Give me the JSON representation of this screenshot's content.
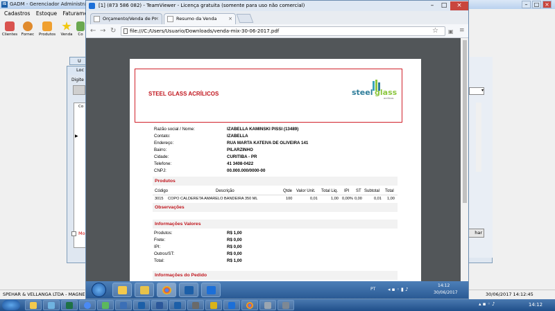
{
  "gadm": {
    "title": "GADM - Gerenciador Administrati",
    "menu": [
      "Cadastros",
      "Estoque",
      "Faturamento"
    ],
    "toolbar": [
      {
        "label": "Clientes",
        "icon": "clients-icon",
        "color": "#d9534f"
      },
      {
        "label": "Fornec",
        "icon": "supplier-icon",
        "color": "#e08a2c"
      },
      {
        "label": "Produtos",
        "icon": "products-icon",
        "color": "#f0a030"
      },
      {
        "label": "Venda",
        "icon": "sale-icon",
        "color": "#f2c811"
      },
      {
        "label": "Co",
        "icon": "other-icon",
        "color": "#6aa84f"
      }
    ],
    "child_title_1": "U",
    "child_title_2": "Loc",
    "group_label": "Digite",
    "grid_header": "Co",
    "checkbox_label": "Mo",
    "close_button": "har",
    "status_left": "SPEHAR & VELLANGA LTDA - MAGNEL",
    "status_right": "30/06/2017 14:12:45",
    "logo": "IS"
  },
  "teamviewer": {
    "title": "[1] (873 586 082) - TeamViewer - Licença gratuita (somente para uso não comercial)"
  },
  "chrome": {
    "tabs": [
      {
        "label": "Orçamento/Venda de Pr",
        "active": false
      },
      {
        "label": "Resumo da Venda",
        "active": true
      }
    ],
    "url": "file:///C:/Users/Usuario/Downloads/venda-mix-30-06-2017.pdf"
  },
  "pdf": {
    "company": "STEEL GLASS ACRÍLICOS",
    "logo_text_a": "steel",
    "logo_text_b": "glass",
    "logo_sub": "acrílicos",
    "customer": [
      {
        "label": "Razão social / Nome:",
        "value": "IZABELLA KAMINSKI PISSI (13489)"
      },
      {
        "label": "Contato:",
        "value": "IZABELLA"
      },
      {
        "label": "Endereço:",
        "value": "RUA MARTA KATEIVA DE OLIVEIRA 141"
      },
      {
        "label": "Bairro:",
        "value": "PILARZINHO"
      },
      {
        "label": "Cidade:",
        "value": "CURITIBA - PR"
      },
      {
        "label": "Telefone:",
        "value": "41 3408-0422"
      },
      {
        "label": "CNPJ:",
        "value": "00.000.000/0000-00"
      }
    ],
    "section_products": "Produtos",
    "columns": [
      "Código",
      "Descrição",
      "Qtde",
      "Valor Unit.",
      "Total Liq.",
      "IPI",
      "ST",
      "Subtotal",
      "Total"
    ],
    "rows": [
      [
        "3015",
        "COPO CALDERETA AMARELO BANDEIRA 350 ML",
        "100",
        "0,01",
        "1,00",
        "0,00%",
        "0,00",
        "0,01",
        "1,00"
      ]
    ],
    "section_obs": "Observações",
    "section_values": "Informações Valores",
    "values": [
      {
        "label": "Produtos:",
        "value": "R$ 1,00"
      },
      {
        "label": "Frete:",
        "value": "R$ 0,00"
      },
      {
        "label": "IPI:",
        "value": "R$ 0,00"
      },
      {
        "label": "Outros/ST:",
        "value": "R$ 0,00"
      },
      {
        "label": "Total:",
        "value": "R$ 1,00"
      }
    ],
    "section_order": "Informações do Pedido",
    "accent": "#c0141c"
  },
  "inner_taskbar": {
    "lang": "PT",
    "time": "14:12",
    "date": "30/06/2017"
  },
  "taskbar": {
    "time": "14:12"
  }
}
